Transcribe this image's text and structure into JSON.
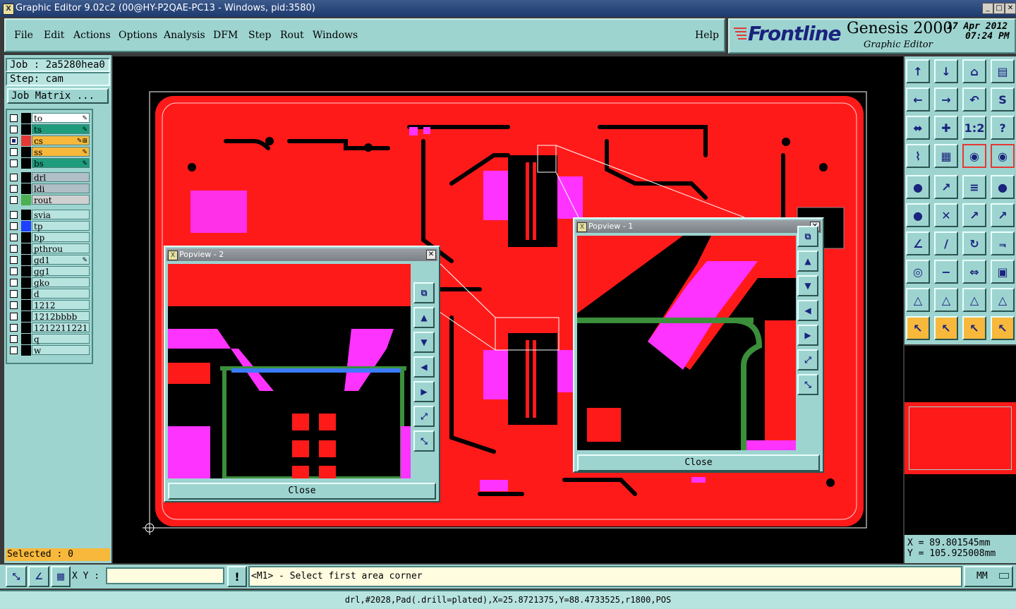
{
  "window": {
    "title": "Graphic Editor 9.02c2 (00@HY-P2QAE-PC13 - Windows, pid:3580)"
  },
  "menu": {
    "items": [
      "File",
      "Edit",
      "Actions",
      "Options",
      "Analysis",
      "DFM",
      "Step",
      "Rout",
      "Windows"
    ],
    "help": "Help"
  },
  "brand": {
    "logo": "Frontline",
    "product": "Genesis 2000",
    "subtitle": "Graphic Editor",
    "date": "17 Apr 2012",
    "time": "07:24 PM"
  },
  "job": {
    "job_label": "Job : 2a5280hea0",
    "step_label": "Step: cam",
    "matrix_button": "Job Matrix ..."
  },
  "layers": [
    {
      "name": "to",
      "color": "#ffffff",
      "box": "#000000",
      "on": false,
      "mark": "✎"
    },
    {
      "name": "ts",
      "color": "#1e9c7c",
      "box": "#000000",
      "on": false,
      "mark": "✎"
    },
    {
      "name": "cs",
      "color": "#f7b83c",
      "box": "#e53935",
      "on": true,
      "mark": "✎⊞"
    },
    {
      "name": "ss",
      "color": "#f7b83c",
      "box": "#000000",
      "on": false,
      "mark": "✎"
    },
    {
      "name": "bs",
      "color": "#1e9c7c",
      "box": "#000000",
      "on": false,
      "mark": "✎"
    },
    {
      "name": "drl",
      "color": "#b0bec5",
      "box": "#000000",
      "on": false,
      "mark": ""
    },
    {
      "name": "ldi",
      "color": "#b0bec5",
      "box": "#000000",
      "on": false,
      "mark": ""
    },
    {
      "name": "rout",
      "color": "#d0d0d0",
      "box": "#4caf50",
      "on": false,
      "mark": ""
    },
    {
      "name": "svia",
      "color": "#b8e4e0",
      "box": "#000000",
      "on": false,
      "mark": ""
    },
    {
      "name": "tp",
      "color": "#b8e4e0",
      "box": "#1e40ff",
      "on": false,
      "mark": ""
    },
    {
      "name": "bp",
      "color": "#b8e4e0",
      "box": "#000000",
      "on": false,
      "mark": ""
    },
    {
      "name": "pthrou",
      "color": "#b8e4e0",
      "box": "#000000",
      "on": false,
      "mark": ""
    },
    {
      "name": "gd1",
      "color": "#b8e4e0",
      "box": "#000000",
      "on": false,
      "mark": "✎"
    },
    {
      "name": "gg1",
      "color": "#b8e4e0",
      "box": "#000000",
      "on": false,
      "mark": ""
    },
    {
      "name": "gko",
      "color": "#b8e4e0",
      "box": "#000000",
      "on": false,
      "mark": ""
    },
    {
      "name": "d",
      "color": "#b8e4e0",
      "box": "#000000",
      "on": false,
      "mark": ""
    },
    {
      "name": "1212",
      "color": "#b8e4e0",
      "box": "#000000",
      "on": false,
      "mark": ""
    },
    {
      "name": "1212bbbb",
      "color": "#b8e4e0",
      "box": "#000000",
      "on": false,
      "mark": ""
    },
    {
      "name": "1212211221",
      "color": "#b8e4e0",
      "box": "#000000",
      "on": false,
      "mark": ""
    },
    {
      "name": "q",
      "color": "#b8e4e0",
      "box": "#000000",
      "on": false,
      "mark": ""
    },
    {
      "name": "w",
      "color": "#b8e4e0",
      "box": "#000000",
      "on": false,
      "mark": ""
    }
  ],
  "selected": "Selected : 0",
  "popview1": {
    "title": "Popview - 1",
    "close": "Close"
  },
  "popview2": {
    "title": "Popview - 2",
    "close": "Close"
  },
  "coords": {
    "x": "X = 89.801545mm",
    "y": "Y = 105.925008mm"
  },
  "status": {
    "xy_label": "X Y :",
    "xy_value": "",
    "bang": "!",
    "prompt": "<M1> - Select first area corner",
    "units": "MM"
  },
  "info": "drl,#2028,Pad(.drill=plated),X=25.8721375,Y=88.4733525,r1800,POS",
  "colors": {
    "board": "#ff1a1a",
    "pad": "#ff33ff",
    "panel": "#9ed4d0",
    "accent": "#f7b83c"
  },
  "toolbar_icons": [
    "pan-up",
    "pan-down",
    "home",
    "window",
    "pan-left",
    "pan-right",
    "undo",
    "flip",
    "fit",
    "center",
    "scale-1-2",
    "help",
    "snap",
    "grid",
    "layer-a",
    "layer-b",
    "pick",
    "measure",
    "ruler",
    "circle",
    "net",
    "cross",
    "ratsnest-a",
    "ratsnest-b",
    "angle",
    "line",
    "rotate",
    "mirror",
    "pad",
    "edge",
    "dimension",
    "group",
    "triangle-a",
    "triangle-b",
    "triangle-c",
    "triangle-d",
    "select",
    "select-box",
    "select-poly",
    "select-net"
  ],
  "toolbar_labels": [
    "↑",
    "↓",
    "⌂",
    "▤",
    "←",
    "→",
    "↶",
    "S",
    "⬌",
    "✚",
    "1:2",
    "?",
    "⌇",
    "▦",
    "◉",
    "◉",
    "●",
    "↗",
    "≡",
    "●",
    "●",
    "✕",
    "↗",
    "↗",
    "∠",
    "∕",
    "↻",
    "⫬",
    "◎",
    "−",
    "⇔",
    "▣",
    "△",
    "△",
    "△",
    "△",
    "↖",
    "↖",
    "↖",
    "↖"
  ]
}
